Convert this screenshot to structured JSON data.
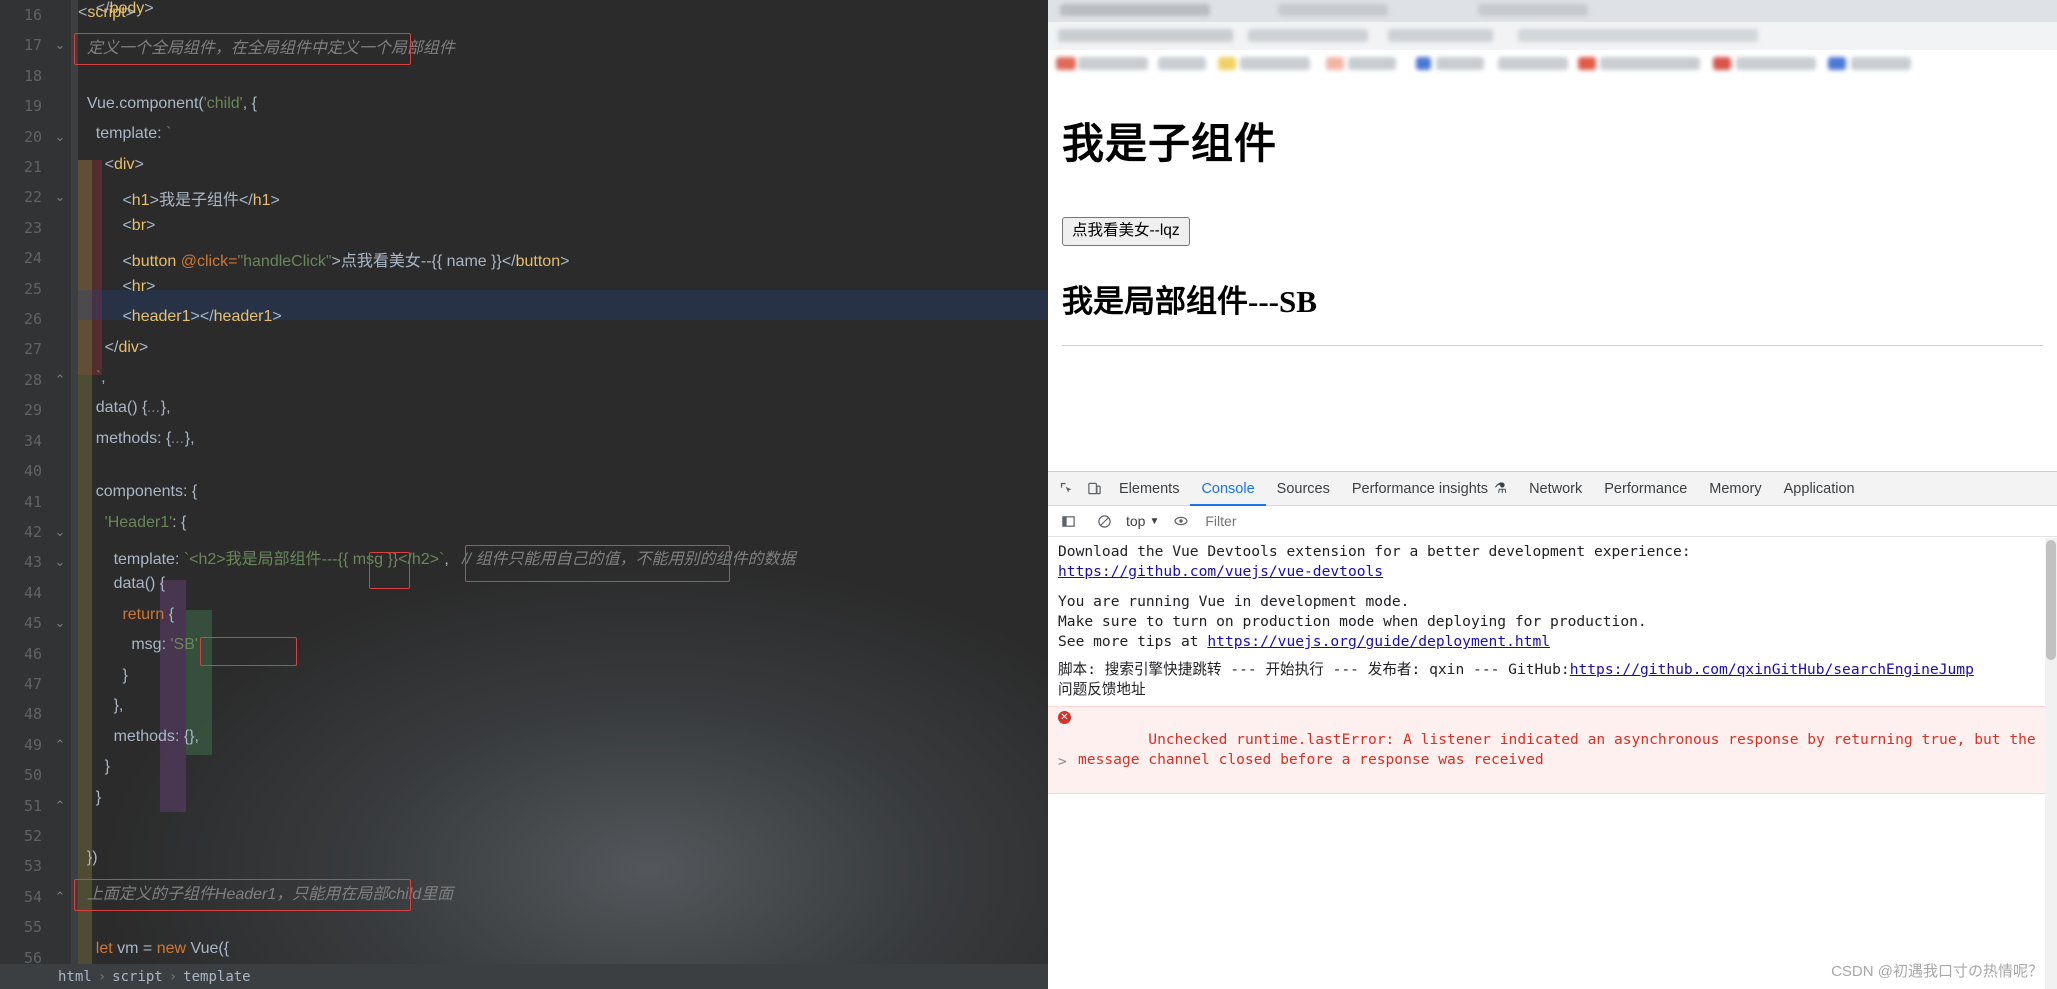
{
  "editor": {
    "line_numbers": [
      "16",
      "17",
      "18",
      "19",
      "20",
      "21",
      "22",
      "23",
      "24",
      "25",
      "26",
      "27",
      "28",
      "29",
      "34",
      "40",
      "41",
      "42",
      "43",
      "44",
      "45",
      "46",
      "47",
      "48",
      "49",
      "50",
      "51",
      "52",
      "53",
      "54",
      "55",
      "56"
    ],
    "lines": [
      "    </body>",
      "<script>",
      "    //  定义一个全局组件，在全局组件中定义一个局部组件",
      "",
      "    Vue.component('child', {",
      "      template: `",
      "        <div>",
      "            <h1>我是子组件</h1>",
      "            <br>",
      "            <button @click=\"handleClick\">点我看美女--{{ name }}</button>",
      "            <hr>",
      "            <header1></header1>",
      "        </div>",
      "      `,",
      "      data() {...},",
      "      methods: {...},",
      "",
      "      components: {",
      "        'Header1': {",
      "          template: `<h2>我是局部组件---{{ msg }}</h2>`,   // 组件只能用自己的值，不能用别的组件的数据",
      "          data() {",
      "            return {",
      "              msg: 'SB'",
      "            }",
      "          },",
      "          methods: {},",
      "        }",
      "      }",
      "",
      "    })",
      "    //  上面定义的子组件Header1，只能用在局部child里面",
      "",
      "    let vm = new Vue({"
    ],
    "breadcrumb": [
      "html",
      "script",
      "template"
    ],
    "annotations": [
      "定义一个全局组件，在全局组件中定义一个局部组件",
      "msg",
      "组件只能用自己的值，不能用别的组件的数据",
      "msg: 'SB'",
      "上面定义的子组件Header1，只能用在局部child里面"
    ]
  },
  "browser": {
    "page": {
      "heading": "我是子组件",
      "button_label": "点我看美女--lqz",
      "subheading": "我是局部组件---SB"
    },
    "devtools": {
      "tabs": [
        {
          "label": "Elements",
          "active": false
        },
        {
          "label": "Console",
          "active": true
        },
        {
          "label": "Sources",
          "active": false
        },
        {
          "label": "Performance insights",
          "active": false
        },
        {
          "label": "Network",
          "active": false
        },
        {
          "label": "Performance",
          "active": false
        },
        {
          "label": "Memory",
          "active": false
        },
        {
          "label": "Application",
          "active": false
        }
      ],
      "toolbar": {
        "context": "top",
        "filter_placeholder": "Filter"
      },
      "messages": [
        {
          "type": "log",
          "text": "Download the Vue Devtools extension for a better development experience:"
        },
        {
          "type": "link",
          "text": "https://github.com/vuejs/vue-devtools"
        },
        {
          "type": "log",
          "text": "You are running Vue in development mode."
        },
        {
          "type": "log",
          "text": "Make sure to turn on production mode when deploying for production."
        },
        {
          "type": "log",
          "text": "See more tips at "
        },
        {
          "type": "link",
          "text": "https://vuejs.org/guide/deployment.html"
        },
        {
          "type": "log",
          "text": "脚本: 搜索引擎快捷跳转 --- 开始执行 --- 发布者: qxin --- GitHub:"
        },
        {
          "type": "link",
          "text": "https://github.com/qxinGitHub/searchEngineJump"
        },
        {
          "type": "log",
          "text": "问题反馈地址"
        },
        {
          "type": "error",
          "text": "Unchecked runtime.lastError: A listener indicated an asynchronous response by returning true, but the message channel closed before a response was received"
        }
      ],
      "prompt": ">"
    }
  },
  "watermark": "CSDN @初遇我口寸の热情呢？",
  "colors": {
    "accent_blue": "#1a73e8",
    "error_red": "#d93025",
    "annotation_red": "#d84141",
    "editor_bg": "#2b2b2b"
  }
}
